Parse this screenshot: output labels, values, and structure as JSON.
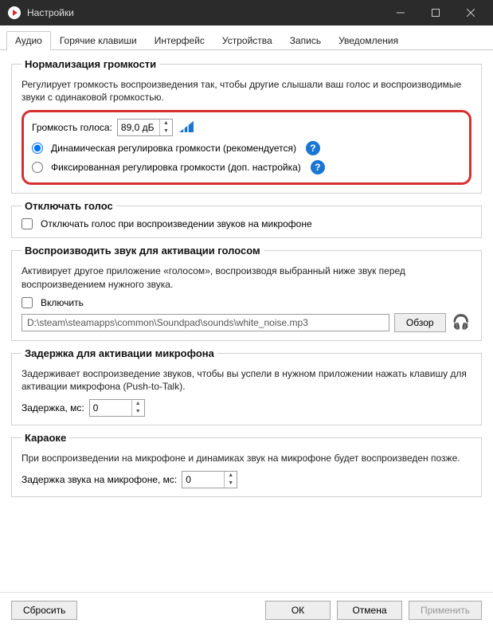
{
  "window": {
    "title": "Настройки"
  },
  "tabs": {
    "audio": "Аудио",
    "hotkeys": "Горячие клавиши",
    "interface": "Интерфейс",
    "devices": "Устройства",
    "record": "Запись",
    "notifications": "Уведомления"
  },
  "normalization": {
    "legend": "Нормализация громкости",
    "desc": "Регулирует громкость воспроизведения так, чтобы другие слышали ваш голос и воспроизводимые звуки с одинаковой громкостью.",
    "voice_label": "Громкость голоса:",
    "voice_value": "89,0 дБ",
    "opt_dynamic": "Динамическая регулировка громкости (рекомендуется)",
    "opt_fixed": "Фиксированная регулировка громкости (доп. настройка)"
  },
  "mute_voice": {
    "legend": "Отключать голос",
    "checkbox": "Отключать голос при воспроизведении звуков на микрофоне"
  },
  "voice_activation": {
    "legend": "Воспроизводить звук для активации голосом",
    "desc": "Активирует другое приложение «голосом», воспроизводя выбранный ниже звук перед воспроизведением нужного звука.",
    "enable": "Включить",
    "path": "D:\\steam\\steamapps\\common\\Soundpad\\sounds\\white_noise.mp3",
    "browse": "Обзор"
  },
  "mic_delay": {
    "legend": "Задержка для активации микрофона",
    "desc": "Задерживает воспроизведение звуков, чтобы вы успели в нужном приложении нажать клавишу для активации микрофона (Push-to-Talk).",
    "delay_label": "Задержка, мс:",
    "delay_value": "0"
  },
  "karaoke": {
    "legend": "Караоке",
    "desc": "При воспроизведении на микрофоне и динамиках звук на микрофоне будет воспроизведен позже.",
    "delay_label": "Задержка звука на микрофоне, мс:",
    "delay_value": "0"
  },
  "footer": {
    "reset": "Сбросить",
    "ok": "ОК",
    "cancel": "Отмена",
    "apply": "Применить"
  },
  "icons": {
    "help": "?",
    "headphones": "🎧"
  }
}
